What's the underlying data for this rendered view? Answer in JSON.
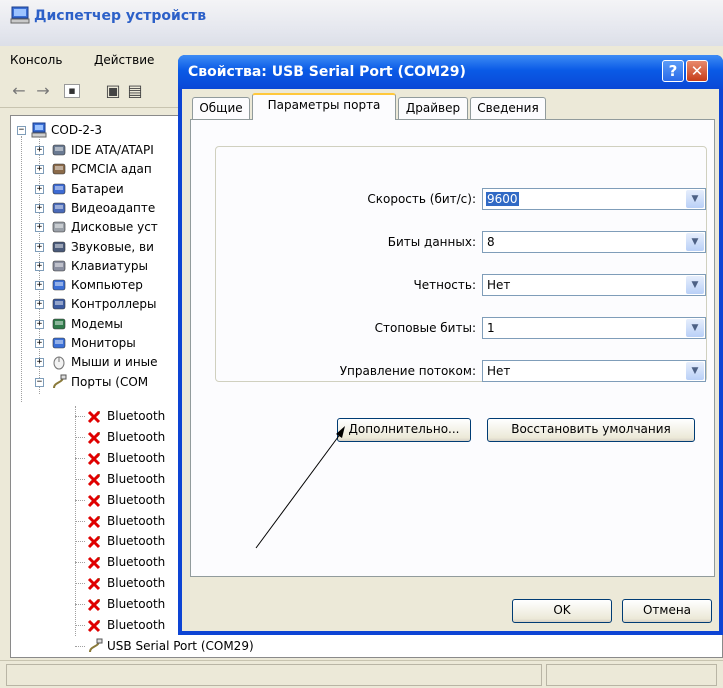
{
  "device_manager": {
    "title": "Диспетчер устройств",
    "menu": [
      "Консоль",
      "Действие"
    ],
    "tree": {
      "root": "COD-2-3",
      "categories": [
        {
          "label": "IDE ATA/ATAPI",
          "icon": "ide-controller-icon"
        },
        {
          "label": "PCMCIA адап",
          "icon": "pcmcia-icon"
        },
        {
          "label": "Батареи",
          "icon": "battery-icon"
        },
        {
          "label": "Видеоадапте",
          "icon": "display-adapter-icon"
        },
        {
          "label": "Дисковые уст",
          "icon": "disk-drive-icon"
        },
        {
          "label": "Звуковые, ви",
          "icon": "sound-icon"
        },
        {
          "label": "Клавиатуры",
          "icon": "keyboard-icon"
        },
        {
          "label": "Компьютер",
          "icon": "computer-icon"
        },
        {
          "label": "Контроллеры",
          "icon": "usb-controller-icon"
        },
        {
          "label": "Модемы",
          "icon": "modem-icon"
        },
        {
          "label": "Мониторы",
          "icon": "monitor-icon"
        },
        {
          "label": "Мыши и иные",
          "icon": "mouse-icon"
        },
        {
          "label": "Порты (COM",
          "icon": "port-icon"
        }
      ],
      "ports": [
        "Bluetooth",
        "Bluetooth",
        "Bluetooth",
        "Bluetooth",
        "Bluetooth",
        "Bluetooth",
        "Bluetooth",
        "Bluetooth",
        "Bluetooth",
        "Bluetooth",
        "Bluetooth"
      ],
      "usb_port": "USB Serial Port (COM29)"
    }
  },
  "dialog": {
    "title": "Свойства: USB Serial Port (COM29)",
    "help_label": "?",
    "close_label": "✕",
    "tabs": [
      "Общие",
      "Параметры порта",
      "Драйвер",
      "Сведения"
    ],
    "active_tab": "Параметры порта",
    "fields": [
      {
        "label": "Скорость (бит/с):",
        "value": "9600"
      },
      {
        "label": "Биты данных:",
        "value": "8"
      },
      {
        "label": "Четность:",
        "value": "Нет"
      },
      {
        "label": "Стоповые биты:",
        "value": "1"
      },
      {
        "label": "Управление потоком:",
        "value": "Нет"
      }
    ],
    "advanced_button": "Дополнительно...",
    "restore_button": "Восстановить умолчания",
    "ok_button": "OK",
    "cancel_button": "Отмена"
  },
  "colors": {
    "title_bar": "#0a5ae6",
    "selection": "#316ac5",
    "tab_highlight": "#ffc83c",
    "window_face": "#ece9d8"
  }
}
